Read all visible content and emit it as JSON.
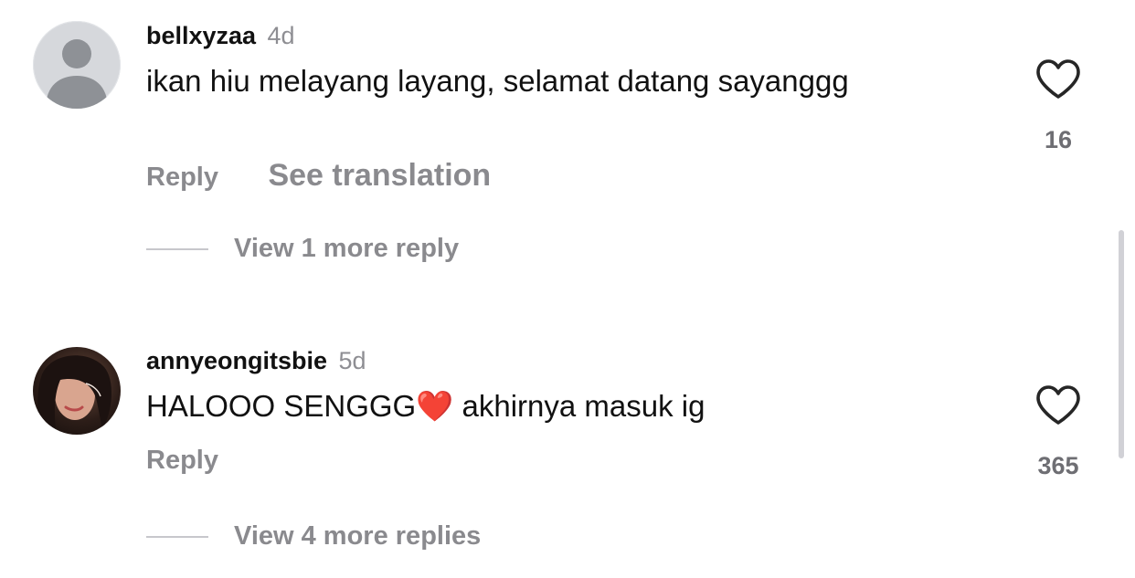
{
  "comments": [
    {
      "username": "bellxyzaa",
      "time": "4d",
      "text": "ikan hiu melayang layang, selamat datang sayanggg",
      "reply_label": "Reply",
      "translate_label": "See translation",
      "likes": "16",
      "view_replies_label": "View 1 more reply",
      "avatar": "default-avatar-icon"
    },
    {
      "username": "annyeongitsbie",
      "time": "5d",
      "text_before_emoji": "HALOOO SENGGG",
      "emoji": "❤️",
      "text_after_emoji": " akhirnya masuk ig",
      "reply_label": "Reply",
      "likes": "365",
      "view_replies_label": "View 4 more replies",
      "avatar": "profile-photo"
    }
  ],
  "colors": {
    "text": "#111111",
    "secondary": "#8a8a8e",
    "heart_outline": "#262626"
  }
}
